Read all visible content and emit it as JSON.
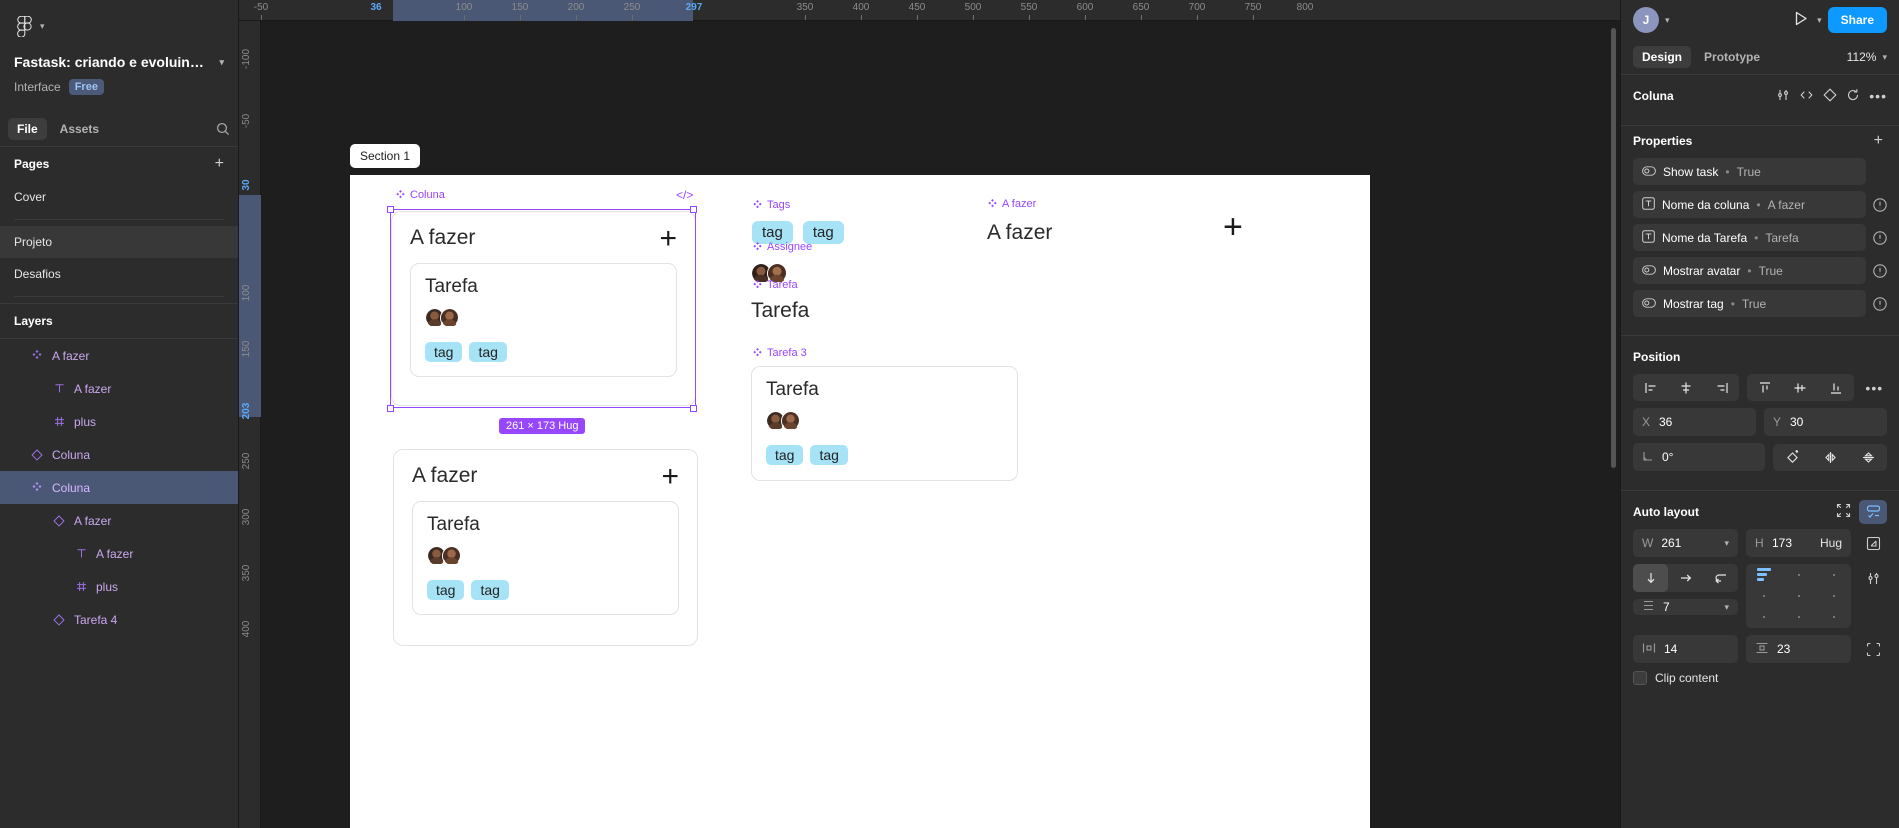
{
  "app": {
    "name": "figma-editor"
  },
  "left_panel": {
    "file_title": "Fastask: criando e evoluind…",
    "interface_label": "Interface",
    "plan_badge": "Free",
    "tabs": [
      {
        "label": "File",
        "active": true
      },
      {
        "label": "Assets",
        "active": false
      }
    ],
    "pages_title": "Pages",
    "pages": [
      {
        "label": "Cover",
        "selected": false
      },
      {
        "label": "Projeto",
        "selected": true
      },
      {
        "label": "Desafios",
        "selected": false
      }
    ],
    "layers_title": "Layers",
    "layers": [
      {
        "label": "A fazer",
        "icon": "component-icon",
        "indent": 1,
        "selected": false
      },
      {
        "label": "A fazer",
        "icon": "text-icon",
        "indent": 2,
        "selected": false
      },
      {
        "label": "plus",
        "icon": "component-instance-icon",
        "indent": 2,
        "selected": false
      },
      {
        "label": "Coluna",
        "icon": "instance-icon",
        "indent": 1,
        "selected": false
      },
      {
        "label": "Coluna",
        "icon": "component-icon",
        "indent": 1,
        "selected": true
      },
      {
        "label": "A fazer",
        "icon": "instance-icon",
        "indent": 2,
        "selected": false
      },
      {
        "label": "A fazer",
        "icon": "text-icon",
        "indent": 3,
        "selected": false
      },
      {
        "label": "plus",
        "icon": "component-instance-icon",
        "indent": 3,
        "selected": false
      },
      {
        "label": "Tarefa 4",
        "icon": "instance-icon",
        "indent": 2,
        "selected": false
      }
    ]
  },
  "canvas": {
    "section_label": "Section 1",
    "ruler_h_ticks": [
      "-50",
      "36",
      "100",
      "150",
      "200",
      "250",
      "297",
      "350",
      "400",
      "450",
      "500",
      "550",
      "600",
      "650",
      "700",
      "750",
      "800"
    ],
    "ruler_v_ticks": [
      "-100",
      "-50",
      "30",
      "100",
      "150",
      "203",
      "250",
      "300",
      "350",
      "400"
    ],
    "ruler_x_highlights": [
      "36",
      "297"
    ],
    "ruler_y_highlights": [
      "30",
      "203"
    ],
    "selection": {
      "dimension_badge": "261 × 173 Hug",
      "component_label": "Coluna",
      "code_icon": "</>"
    },
    "columns": [
      {
        "title": "A fazer",
        "plus": "+",
        "task": {
          "title": "Tarefa",
          "tags": [
            "tag",
            "tag"
          ]
        }
      },
      {
        "title": "A fazer",
        "plus": "+",
        "task": {
          "title": "Tarefa",
          "tags": [
            "tag",
            "tag"
          ]
        }
      }
    ],
    "annotations": [
      {
        "label": "Tags"
      },
      {
        "label": "Assignee"
      },
      {
        "label": "Tarefa"
      },
      {
        "label": "A fazer"
      },
      {
        "label": "Tarefa 3"
      }
    ],
    "loose_tags": [
      "tag",
      "tag"
    ],
    "loose_texts": {
      "tarefa": "Tarefa",
      "a_fazer": "A fazer",
      "plus": "+"
    },
    "tarefa3_card": {
      "title": "Tarefa",
      "tags": [
        "tag",
        "tag"
      ]
    }
  },
  "right_panel": {
    "user_initial": "J",
    "share_label": "Share",
    "tabs": [
      {
        "label": "Design",
        "active": true
      },
      {
        "label": "Prototype",
        "active": false
      }
    ],
    "zoom": "112%",
    "object_name": "Coluna",
    "properties_title": "Properties",
    "properties": [
      {
        "icon": "boolean-icon",
        "name": "Show task",
        "sep": "•",
        "value": "True",
        "warn": false
      },
      {
        "icon": "text-prop-icon",
        "name": "Nome da coluna",
        "sep": "•",
        "value": "A fazer",
        "warn": true
      },
      {
        "icon": "text-prop-icon",
        "name": "Nome da Tarefa",
        "sep": "•",
        "value": "Tarefa",
        "warn": true
      },
      {
        "icon": "boolean-icon",
        "name": "Mostrar avatar",
        "sep": "•",
        "value": "True",
        "warn": true
      },
      {
        "icon": "boolean-icon",
        "name": "Mostrar tag",
        "sep": "•",
        "value": "True",
        "warn": true
      }
    ],
    "position_title": "Position",
    "position": {
      "x_key": "X",
      "x": "36",
      "y_key": "Y",
      "y": "30",
      "rotation": "0°"
    },
    "autolayout_title": "Auto layout",
    "autolayout": {
      "w_key": "W",
      "w": "261",
      "h_key": "H",
      "h": "173",
      "h_mode": "Hug",
      "gap": "7",
      "pad_h": "14",
      "pad_v": "23",
      "clip_label": "Clip content"
    }
  }
}
